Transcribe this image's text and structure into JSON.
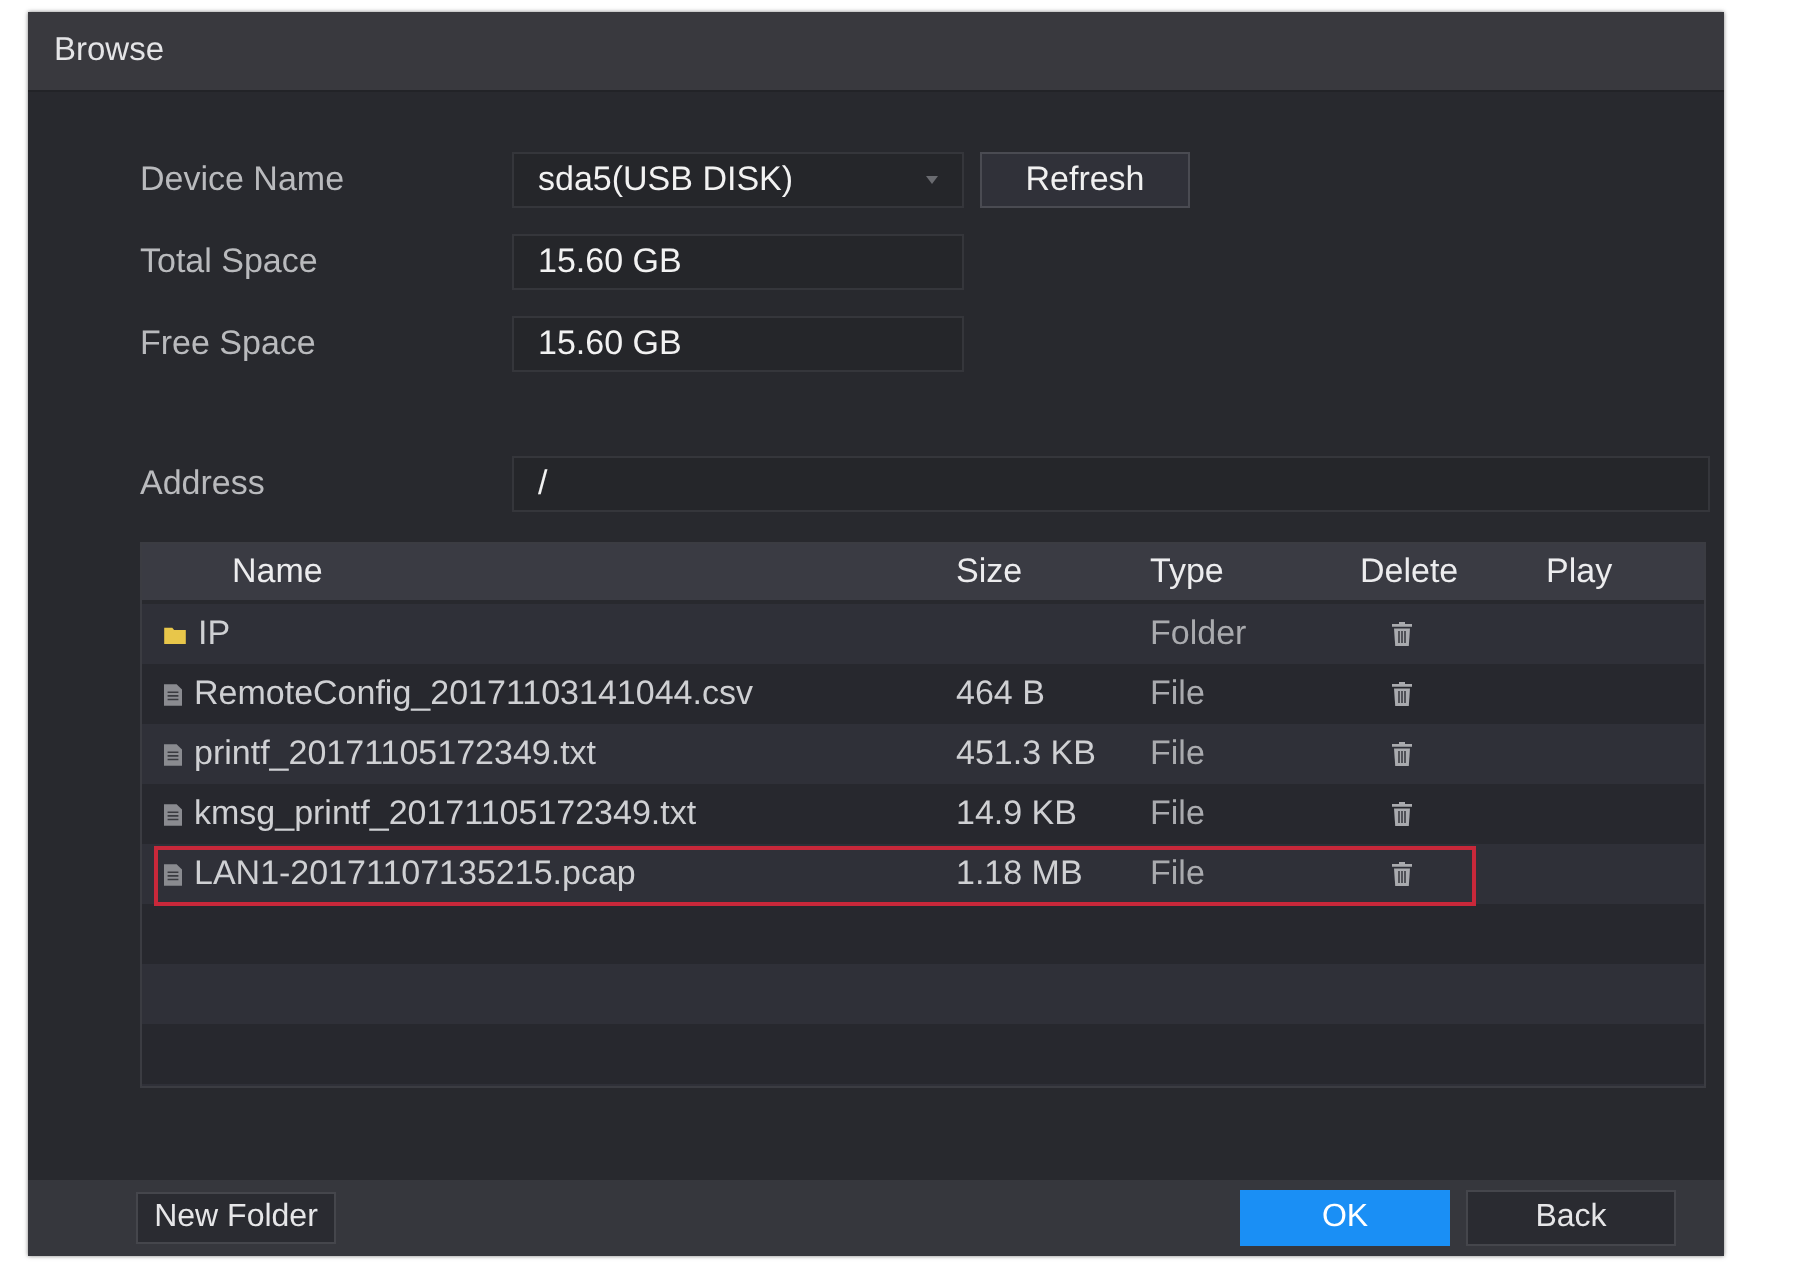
{
  "window": {
    "title": "Browse"
  },
  "device": {
    "fields": [
      {
        "label": "Device Name",
        "value": "sda5(USB DISK)",
        "kind": "dropdown"
      },
      {
        "label": "Total Space",
        "value": "15.60 GB",
        "kind": "text"
      },
      {
        "label": "Free Space",
        "value": "15.60 GB",
        "kind": "text"
      }
    ],
    "refresh_button": "Refresh"
  },
  "address": {
    "label": "Address",
    "value": "/"
  },
  "table": {
    "columns": [
      "Name",
      "Size",
      "Type",
      "Delete",
      "Play"
    ],
    "rows": [
      {
        "kind": "folder",
        "name": "IP",
        "type": "Folder",
        "highlighted": false
      },
      {
        "kind": "file",
        "name": "RemoteConfig_20171103141044.csv",
        "size": "464 B",
        "type": "File",
        "highlighted": false
      },
      {
        "kind": "file",
        "name": "printf_20171105172349.txt",
        "size": "451.3 KB",
        "type": "File",
        "highlighted": false
      },
      {
        "kind": "file",
        "name": "kmsg_printf_20171105172349.txt",
        "size": "14.9 KB",
        "type": "File",
        "highlighted": false
      },
      {
        "kind": "file",
        "name": "LAN1-20171107135215.pcap",
        "size": "1.18 MB",
        "type": "File",
        "highlighted": true
      }
    ]
  },
  "footer": {
    "new_folder_button": "New Folder",
    "buttons": [
      {
        "label": "OK",
        "kind": "primary"
      },
      {
        "label": "Back",
        "kind": "secondary"
      }
    ]
  }
}
